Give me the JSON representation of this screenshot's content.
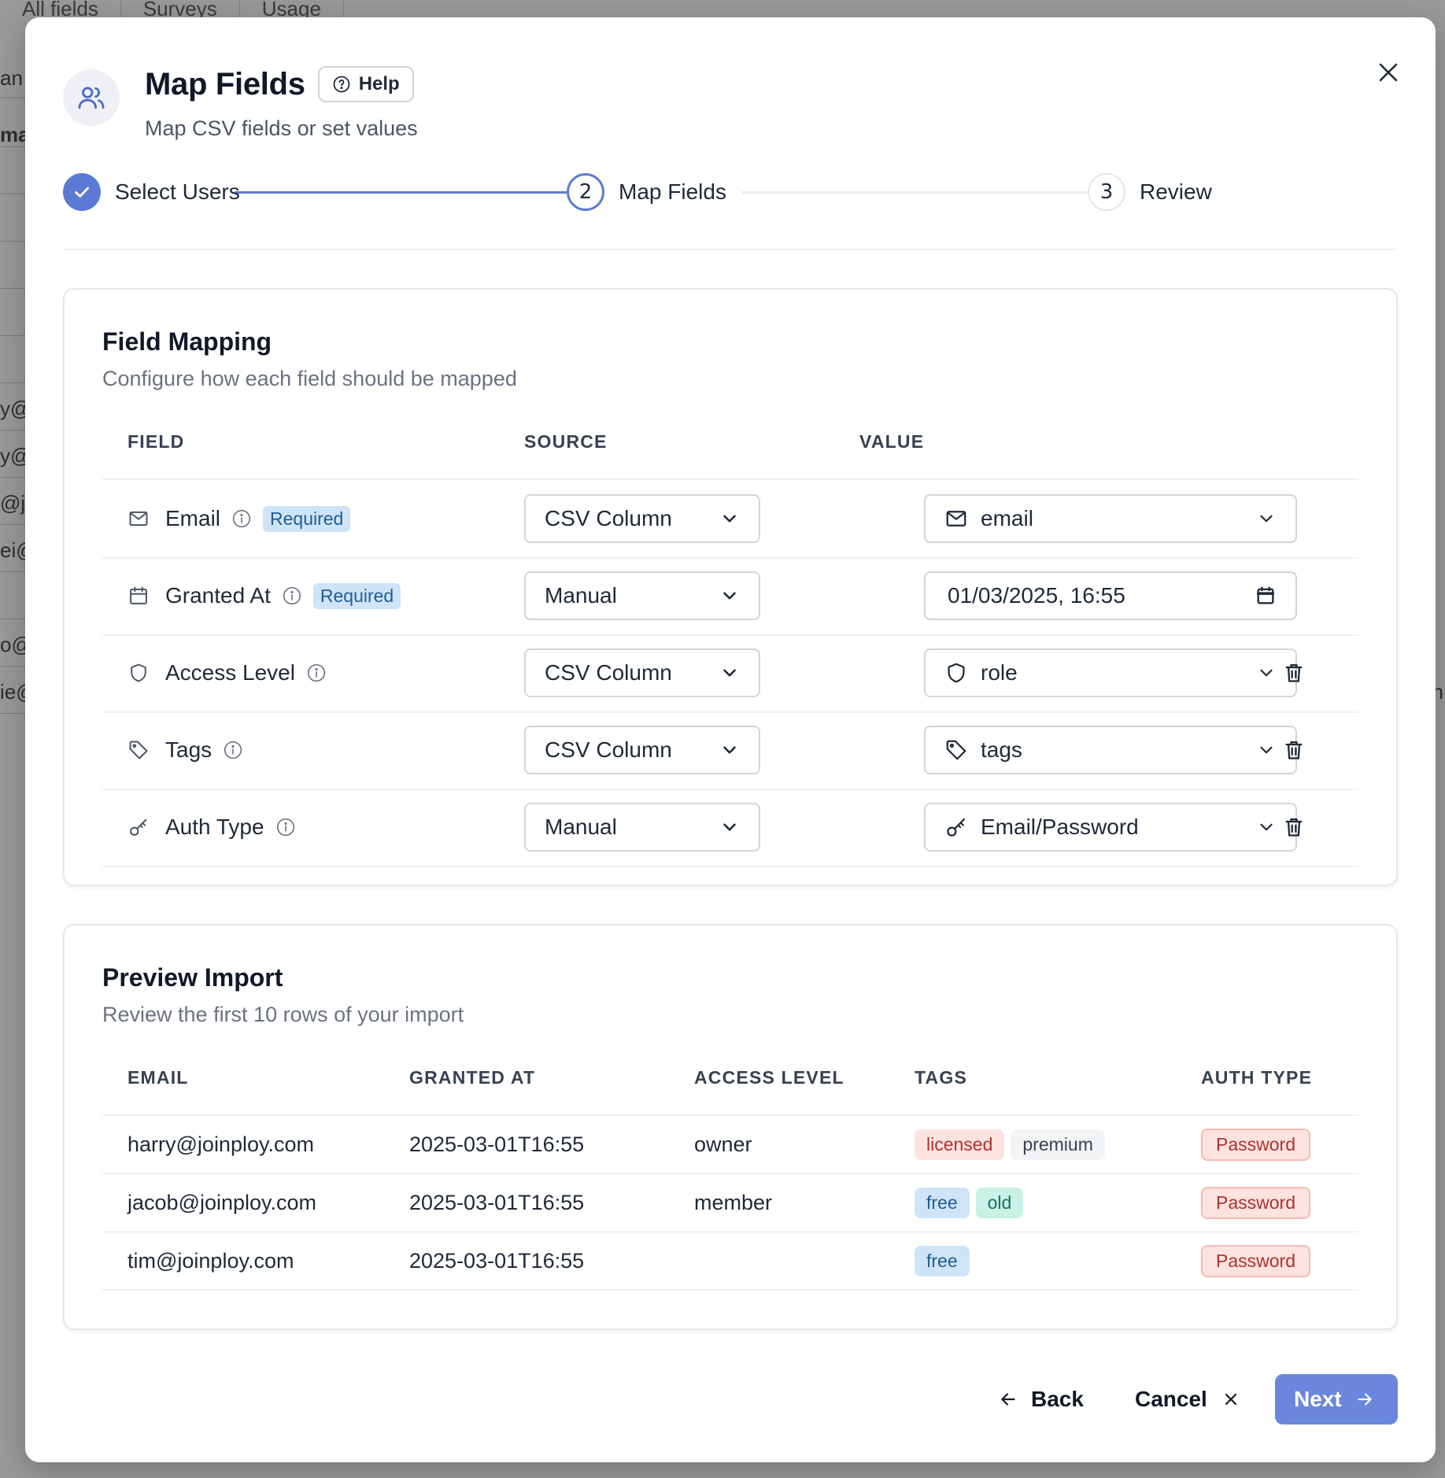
{
  "background": {
    "tabs": [
      "All fields",
      "Surveys",
      "Usage"
    ],
    "fragments": [
      "an",
      "ma",
      "y@",
      "y@j",
      "@jo",
      "ei@",
      "o@",
      "ie@"
    ],
    "right_fragment": "n"
  },
  "modal": {
    "title": "Map Fields",
    "help_label": "Help",
    "subtitle": "Map CSV fields or set values"
  },
  "stepper": {
    "steps": [
      {
        "label": "Select Users",
        "status": "done",
        "number": ""
      },
      {
        "label": "Map Fields",
        "status": "active",
        "number": "2"
      },
      {
        "label": "Review",
        "status": "todo",
        "number": "3"
      }
    ]
  },
  "mapping": {
    "title": "Field Mapping",
    "subtitle": "Configure how each field should be mapped",
    "headers": {
      "field": "FIELD",
      "source": "SOURCE",
      "value": "VALUE"
    },
    "rows": [
      {
        "field": "Email",
        "required": "Required",
        "source": "CSV Column",
        "value": "email",
        "icon": "mail-icon"
      },
      {
        "field": "Granted At",
        "required": "Required",
        "source": "Manual",
        "value": "01/03/2025, 16:55",
        "icon": "calendar-icon"
      },
      {
        "field": "Access Level",
        "source": "CSV Column",
        "value": "role",
        "icon": "shield-icon"
      },
      {
        "field": "Tags",
        "source": "CSV Column",
        "value": "tags",
        "icon": "tag-icon"
      },
      {
        "field": "Auth Type",
        "source": "Manual",
        "value": "Email/Password",
        "icon": "key-icon"
      }
    ]
  },
  "preview": {
    "title": "Preview Import",
    "subtitle": "Review the first 10 rows of your import",
    "headers": {
      "email": "EMAIL",
      "granted_at": "GRANTED AT",
      "access_level": "ACCESS LEVEL",
      "tags": "TAGS",
      "auth_type": "AUTH TYPE"
    },
    "rows": [
      {
        "email": "harry@joinploy.com",
        "granted_at": "2025-03-01T16:55",
        "access_level": "owner",
        "tags": [
          "licensed",
          "premium"
        ],
        "auth_type": "Password"
      },
      {
        "email": "jacob@joinploy.com",
        "granted_at": "2025-03-01T16:55",
        "access_level": "member",
        "tags": [
          "free",
          "old"
        ],
        "auth_type": "Password"
      },
      {
        "email": "tim@joinploy.com",
        "granted_at": "2025-03-01T16:55",
        "access_level": "",
        "tags": [
          "free"
        ],
        "auth_type": "Password"
      }
    ]
  },
  "footer": {
    "back_label": "Back",
    "cancel_label": "Cancel",
    "next_label": "Next"
  },
  "colors": {
    "accent": "#5b7ad6",
    "next_button": "#6a87dd",
    "required_badge": "#cfe4f7",
    "auth_badge": "#fde3e0"
  }
}
